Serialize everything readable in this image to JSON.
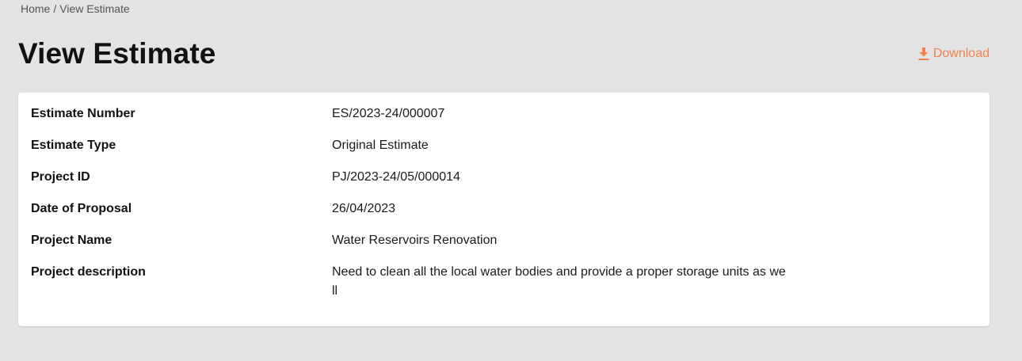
{
  "breadcrumb": {
    "home": "Home",
    "separator": "/",
    "current": "View Estimate"
  },
  "page_title": "View Estimate",
  "download": {
    "label": "Download",
    "icon": "download-icon",
    "color": "#f0824d"
  },
  "details": {
    "rows": [
      {
        "label": "Estimate Number",
        "value": "ES/2023-24/000007"
      },
      {
        "label": "Estimate Type",
        "value": "Original Estimate"
      },
      {
        "label": "Project ID",
        "value": "PJ/2023-24/05/000014"
      },
      {
        "label": "Date of Proposal",
        "value": "26/04/2023"
      },
      {
        "label": "Project Name",
        "value": "Water Reservoirs Renovation"
      },
      {
        "label": "Project description",
        "value": "Need to clean all the local water bodies and provide a proper storage units as well"
      }
    ]
  }
}
